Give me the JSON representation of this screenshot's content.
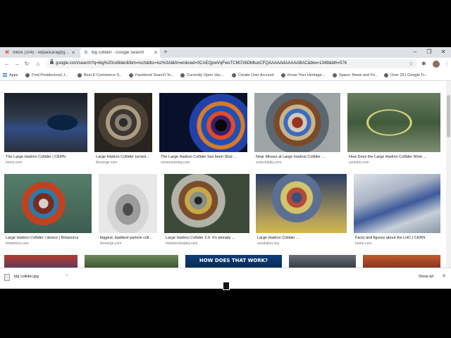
{
  "browser": {
    "tabs": [
      {
        "label": "Inbox (104) - edpackaraj@gmai...",
        "icon": "gmail-icon",
        "active": false
      },
      {
        "label": "big collider - Google Search",
        "icon": "google-icon",
        "active": true
      }
    ],
    "new_tab_symbol": "+",
    "window_controls": {
      "minimize": "–",
      "maximize": "❐",
      "close": "✕"
    },
    "nav": {
      "back": "←",
      "forward": "→",
      "reload": "↻",
      "home": "⌂"
    },
    "url": "google.com/search?q=big%20collider&tbm=isch&tbs=isz%3Al&hl=en&ved=0CAEQpwVqFwoTCMi7z6DMtuoCFQAAAAAdAAAAABAC&biw=1349&bih=576",
    "bookmarks": [
      {
        "label": "Apps"
      },
      {
        "label": "Find Postdoctoral J..."
      },
      {
        "label": "Best E-Commerce S..."
      },
      {
        "label": "Facebook Search To..."
      },
      {
        "label": "Currently Open Vac..."
      },
      {
        "label": "Create User Account"
      },
      {
        "label": "Know Your Heritage..."
      },
      {
        "label": "Space: News and Fe..."
      },
      {
        "label": "Over 251 Google Fr..."
      }
    ]
  },
  "results": [
    {
      "title": "The Large Hadron Collider | CERN",
      "source": "home.cern"
    },
    {
      "title": "Large Hadron Collider turned...",
      "source": "theverge.com"
    },
    {
      "title": "The Large Hadron Collider has been Shut ...",
      "source": "universetoday.com"
    },
    {
      "title": "Near Misses at Large Hadron Collider ...",
      "source": "scitechdaily.com"
    },
    {
      "title": "How Does the Large Hadron Collider Work ...",
      "source": "youtube.com"
    },
    {
      "title": "Large Hadron Collider | device | Britannica",
      "source": "britannica.com"
    },
    {
      "title": "biggest, baddest particle coll...",
      "source": "theverge.com"
    },
    {
      "title": "Large Hadron Collider 2.0: It's already ...",
      "source": "howitworksdaily.com"
    },
    {
      "title": "Large Hadron Collider ...",
      "source": "eurekalert.org"
    },
    {
      "title": "Facts and figures about the LHC | CERN",
      "source": "home.cern"
    }
  ],
  "partial_row_banner": "HOW DOES THAT WORK?",
  "download_shelf": {
    "filename": "big collider.jpg",
    "show_all": "Show all",
    "close": "✕"
  }
}
